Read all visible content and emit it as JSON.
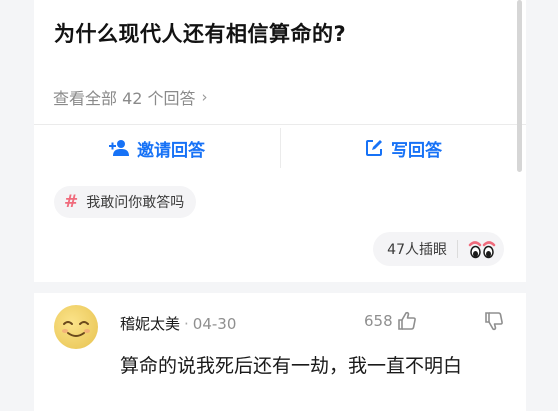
{
  "question": {
    "title": "为什么现代人还有相信算命的?",
    "view_all_label": "查看全部 42 个回答",
    "answer_count": 42
  },
  "actions": {
    "invite_label": "邀请回答",
    "write_label": "写回答"
  },
  "topic": {
    "label": "我敢问你敢答吗"
  },
  "reaction": {
    "label": "47人插眼",
    "count": 47
  },
  "answer": {
    "author": "稽妮太美",
    "date": "04-30",
    "likes": "658",
    "text": "算命的说我死后还有一劫，我一直不明白"
  },
  "colors": {
    "accent": "#1772f6",
    "topic_hash": "#f06b7c",
    "background": "#f4f5f7",
    "card": "#ffffff"
  },
  "icons": {
    "invite": "add-user-icon",
    "write": "edit-icon",
    "topic": "hash-icon",
    "reaction": "eyes-icon",
    "view_all": "chevron-right-icon",
    "like": "thumbs-up-icon",
    "dislike": "thumbs-down-icon"
  }
}
